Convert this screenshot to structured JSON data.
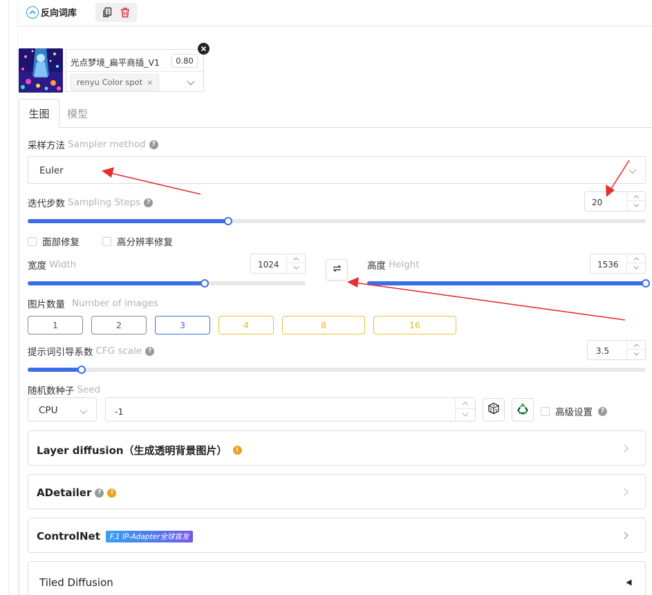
{
  "topbar": {
    "negative_library_label": "反向词库"
  },
  "lora": {
    "name": "光点梦境_扁平商插_V1",
    "weight": "0.80",
    "tag": "renyu Color spot",
    "tag_remove": "×"
  },
  "tabs": {
    "generate": "生图",
    "model": "模型"
  },
  "sampler": {
    "label_cn": "采样方法",
    "label_en": "Sampler method",
    "value": "Euler"
  },
  "steps": {
    "label_cn": "迭代步数",
    "label_en": "Sampling Steps",
    "value": "20",
    "slider_fraction": 0.324
  },
  "checkboxes": {
    "face_restore": "面部修复",
    "hires_fix": "高分辨率修复",
    "advanced": "高级设置"
  },
  "width": {
    "label_cn": "宽度",
    "label_en": "Width",
    "value": "1024",
    "slider_fraction": 0.636
  },
  "height": {
    "label_cn": "高度",
    "label_en": "Height",
    "value": "1536",
    "slider_fraction": 1.0
  },
  "num_images": {
    "label_cn": "图片数量",
    "label_en": "Number of images",
    "options": [
      "1",
      "2",
      "3",
      "4",
      "8",
      "16"
    ],
    "selected": "3"
  },
  "cfg": {
    "label_cn": "提示词引导系数",
    "label_en": "CFG scale",
    "value": "3.5",
    "slider_fraction": 0.087
  },
  "seed": {
    "label_cn": "随机数种子",
    "label_en": "Seed",
    "device": "CPU",
    "value": "-1"
  },
  "accordions": {
    "layer_diffusion": "Layer diffusion（生成透明背景图片）",
    "adetailer": "ADetailer",
    "controlnet": "ControlNet",
    "controlnet_badge": "F.1 IP-Adapter全球首发",
    "tiled_diffusion": "Tiled Diffusion"
  },
  "colors": {
    "accent_blue": "#3b6ee6",
    "warning_orange": "#f0a020",
    "annotation_red": "#e62e2e",
    "yellow_option": "#e8c234"
  },
  "icons": {
    "collapse": "chevron-up-circle-icon",
    "copy": "copy-icon",
    "delete": "trash-icon",
    "swap": "swap-arrows-icon",
    "dice": "dice-icon",
    "recycle": "recycle-icon"
  }
}
